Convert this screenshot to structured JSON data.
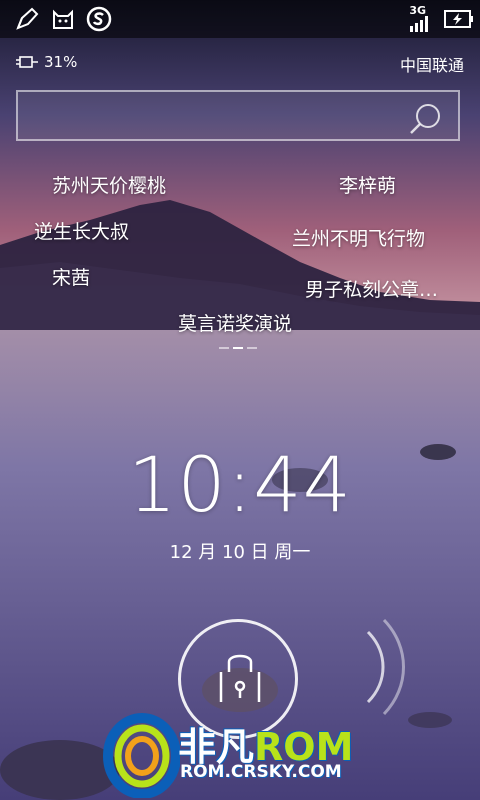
{
  "status_bar": {
    "icons": [
      "brush-icon",
      "cat-icon",
      "s-logo-icon",
      "signal-icon",
      "battery-charging-icon"
    ],
    "network_type": "3G"
  },
  "lock_header": {
    "battery_percent": "31%",
    "carrier": "中国联通"
  },
  "search": {
    "placeholder": ""
  },
  "trending": [
    "苏州天价樱桃",
    "李梓萌",
    "逆生长大叔",
    "兰州不明飞行物",
    "宋茜",
    "男子私刻公章…",
    "莫言诺奖演说"
  ],
  "pager": {
    "count": 3,
    "active": 1
  },
  "clock": {
    "time": "10:44",
    "date": "12 月 10 日 周一"
  },
  "watermark": {
    "brand_cn": "非凡",
    "brand_rom": "ROM",
    "url": "ROM.CRSKY.COM"
  },
  "colors": {
    "watermark_green": "#b8e21a",
    "watermark_blue": "#0b5fb8"
  }
}
